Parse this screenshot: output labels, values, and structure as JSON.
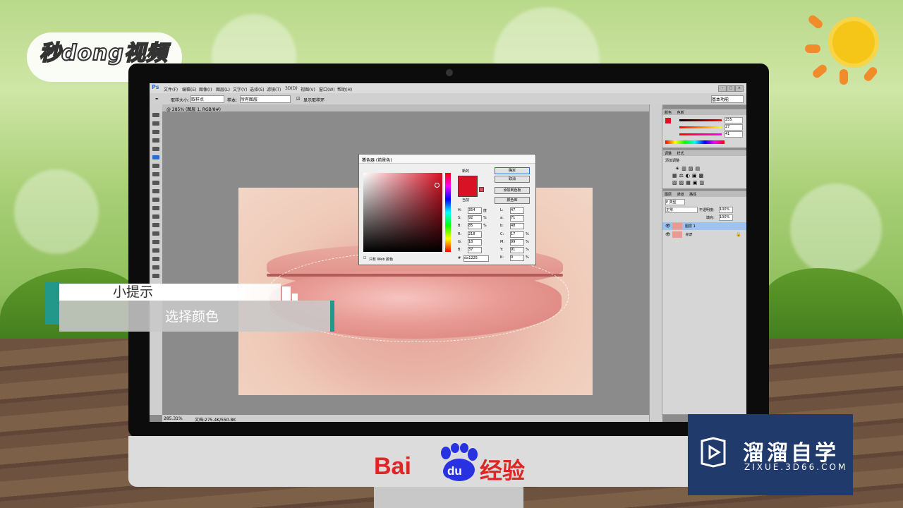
{
  "brand": {
    "text": "秒dong视频"
  },
  "photoshop": {
    "app_label": "Ps",
    "menu": [
      "文件(F)",
      "编辑(E)",
      "图像(I)",
      "图层(L)",
      "文字(Y)",
      "选择(S)",
      "滤镜(T)",
      "3D(D)",
      "视图(V)",
      "窗口(W)",
      "帮助(H)"
    ],
    "options": {
      "sample_size_label": "取样大小:",
      "sample_size_value": "取样点",
      "sample_label": "样本:",
      "sample_value": "所有图层",
      "show_ring_label": "显示取样环",
      "workspace_value": "基本功能"
    },
    "doc_tab": "@ 285% (图层 1, RGB/8#)",
    "status_zoom": "285.31%",
    "status_doc": "文档:275.4K/550.8K",
    "panels": {
      "color_tabs": [
        "颜色",
        "色板"
      ],
      "adjust_tabs": [
        "调整",
        "样式"
      ],
      "adjust_hint": "添加调整",
      "layers_tabs": [
        "图层",
        "通道",
        "路径"
      ],
      "layer_kind": "P 类型",
      "blend_mode": "正常",
      "opacity_label": "不透明度:",
      "opacity_value": "100%",
      "fill_label": "填充:",
      "fill_value": "100%",
      "layers": [
        "图层 1",
        "背景"
      ],
      "color_values": [
        "255",
        "27",
        "41"
      ]
    }
  },
  "color_picker": {
    "title": "拾色器 (前景色)",
    "new_label": "新的",
    "current_label": "当前",
    "buttons": [
      "确定",
      "取消",
      "添加到色板",
      "颜色库"
    ],
    "web_only": "只有 Web 颜色",
    "hsb": [
      {
        "l": "H:",
        "v": "354",
        "u": "度"
      },
      {
        "l": "S:",
        "v": "92",
        "u": "%"
      },
      {
        "l": "B:",
        "v": "85",
        "u": "%"
      }
    ],
    "rgb": [
      {
        "l": "R:",
        "v": "218"
      },
      {
        "l": "G:",
        "v": "18"
      },
      {
        "l": "B:",
        "v": "37"
      }
    ],
    "lab": [
      {
        "l": "L:",
        "v": "47"
      },
      {
        "l": "a:",
        "v": "71"
      },
      {
        "l": "b:",
        "v": "48"
      }
    ],
    "cmyk": [
      {
        "l": "C:",
        "v": "17",
        "u": "%"
      },
      {
        "l": "M:",
        "v": "99",
        "u": "%"
      },
      {
        "l": "Y:",
        "v": "91",
        "u": "%"
      },
      {
        "l": "K:",
        "v": "0",
        "u": "%"
      }
    ],
    "hex_label": "#",
    "hex": "da1225",
    "color": "#da1225"
  },
  "tip": {
    "title": "小提示",
    "text": "选择颜色"
  },
  "baidu": {
    "bai": "Bai",
    "du": "du",
    "jingyan": "经验"
  },
  "zixue": {
    "cn": "溜溜自学",
    "en": "ZIXUE.3D66.COM"
  }
}
